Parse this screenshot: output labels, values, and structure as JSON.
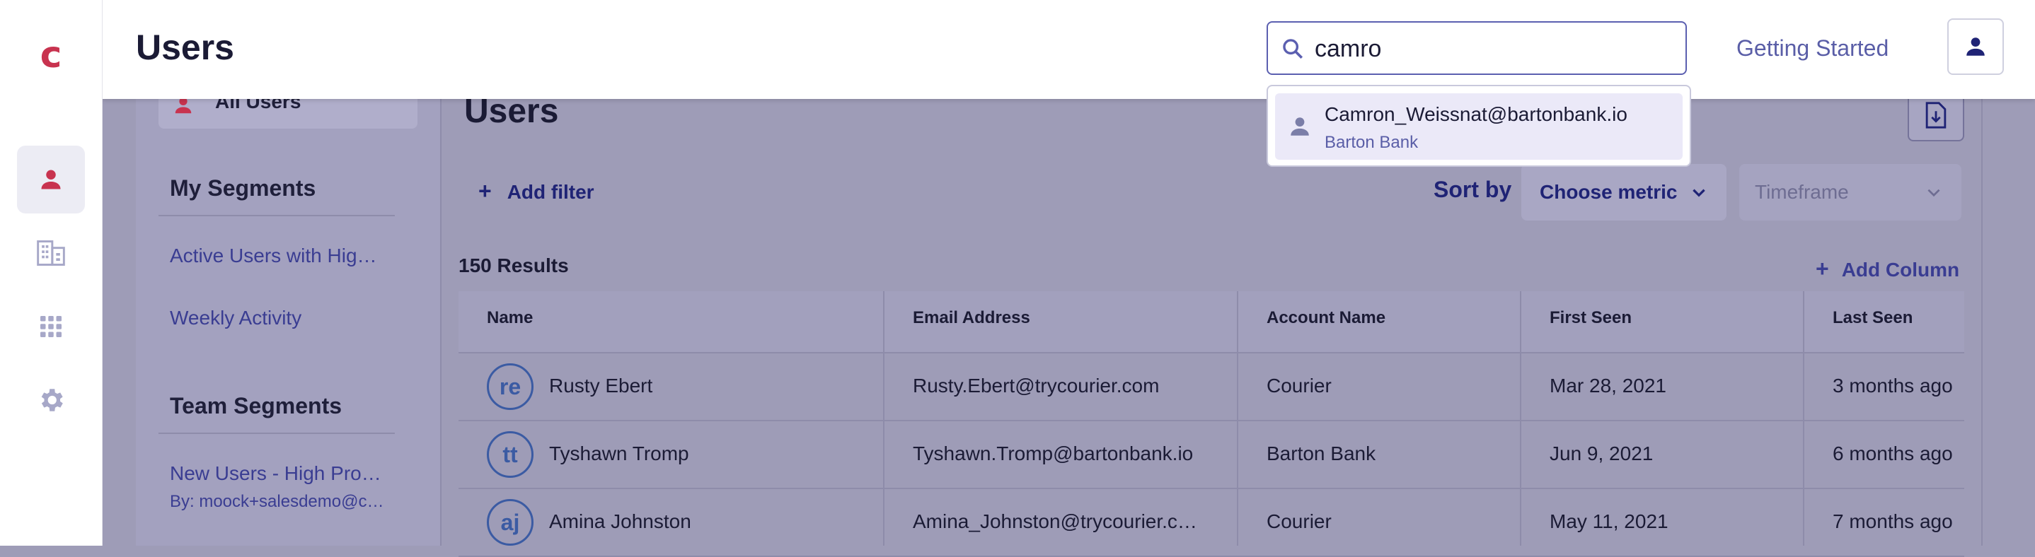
{
  "app": {
    "logo": "c",
    "page_title": "Users"
  },
  "rail": {
    "items": [
      {
        "icon": "person-icon",
        "active": true
      },
      {
        "icon": "building-icon",
        "active": false
      },
      {
        "icon": "apps-grid-icon",
        "active": false
      },
      {
        "icon": "gear-icon",
        "active": false
      }
    ]
  },
  "header": {
    "search_value": "camro",
    "getting_started": "Getting Started"
  },
  "search_results": [
    {
      "email": "Camron_Weissnat@bartonbank.io",
      "account": "Barton Bank"
    }
  ],
  "segments": {
    "all_users": "All Users",
    "my_heading": "My Segments",
    "my_items": [
      "Active Users with Hig…",
      "Weekly Activity"
    ],
    "team_heading": "Team Segments",
    "team_items": [
      {
        "label": "New Users - High Pro…",
        "by": "By: moock+salesdemo@c…"
      }
    ]
  },
  "main": {
    "title": "Users",
    "add_filter": "Add filter",
    "sort_by": "Sort by",
    "choose_metric": "Choose metric",
    "timeframe": "Timeframe",
    "results": "150 Results",
    "add_column": "Add Column"
  },
  "table": {
    "columns": [
      "Name",
      "Email Address",
      "Account Name",
      "First Seen",
      "Last Seen"
    ],
    "rows": [
      {
        "initials": "re",
        "name": "Rusty Ebert",
        "email": "Rusty.Ebert@trycourier.com",
        "account": "Courier",
        "first_seen": "Mar 28, 2021",
        "last_seen": "3 months ago"
      },
      {
        "initials": "tt",
        "name": "Tyshawn Tromp",
        "email": "Tyshawn.Tromp@bartonbank.io",
        "account": "Barton Bank",
        "first_seen": "Jun 9, 2021",
        "last_seen": "6 months ago"
      },
      {
        "initials": "aj",
        "name": "Amina Johnston",
        "email": "Amina_Johnston@trycourier.c…",
        "account": "Courier",
        "first_seen": "May 11, 2021",
        "last_seen": "7 months ago"
      }
    ]
  },
  "colors": {
    "brand": "#c8334f",
    "accent": "#5a5ea7",
    "overlay": "#9e9cb7"
  }
}
